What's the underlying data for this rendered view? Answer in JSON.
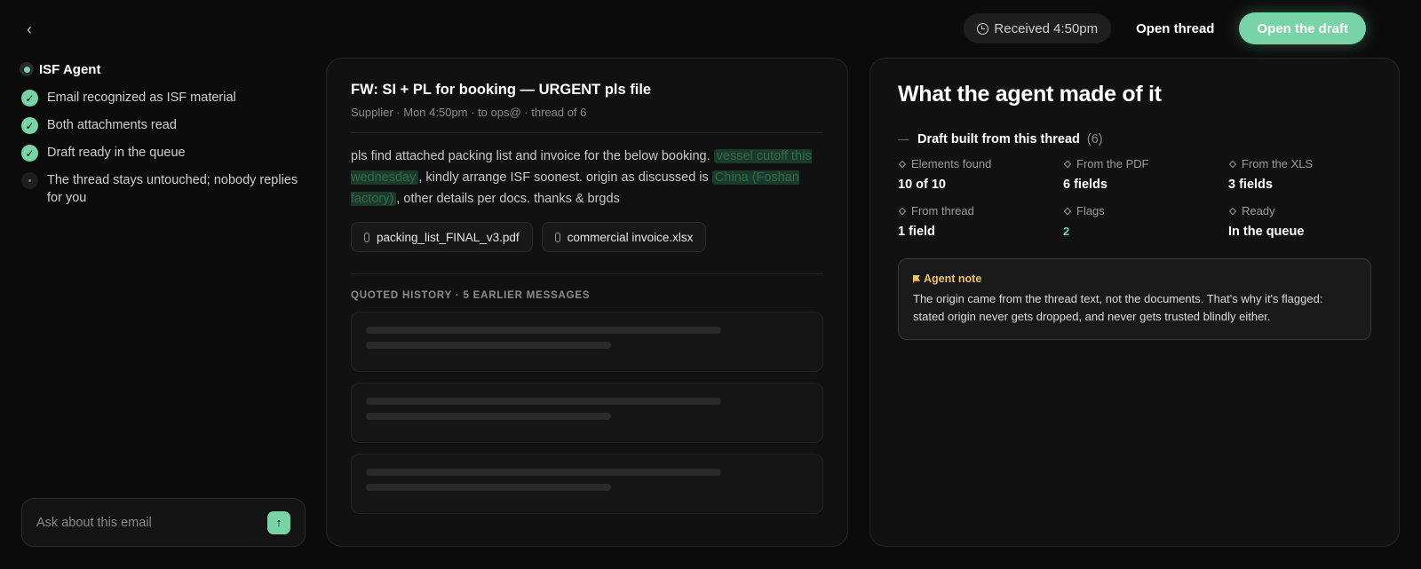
{
  "topbar": {
    "received_label": "Received 4:50pm",
    "open_thread_label": "Open thread",
    "open_draft_label": "Open the draft",
    "accent_color": "#78d3a6"
  },
  "sidebar": {
    "agent_name": "ISF Agent",
    "steps": [
      {
        "label": "Email recognized as ISF material",
        "status": "done"
      },
      {
        "label": "Both attachments read",
        "status": "done"
      },
      {
        "label": "Draft ready in the queue",
        "status": "done"
      },
      {
        "label": "The thread stays untouched; nobody replies for you",
        "status": "pending"
      }
    ],
    "ask_placeholder": "Ask about this email"
  },
  "email": {
    "subject": "FW: SI + PL for booking — URGENT pls file",
    "meta": "Supplier · Mon 4:50pm · to ops@ · thread of 6",
    "body": {
      "part1": "pls find attached packing list and invoice for the below booking. ",
      "highlight1": "vessel cutoff this wednesday",
      "part2": ", kindly arrange ISF soonest. origin as discussed is ",
      "highlight2": "China (Foshan factory)",
      "part3": ", other details per docs. thanks & brgds"
    },
    "attachments": [
      {
        "name": "packing_list_FINAL_v3.pdf"
      },
      {
        "name": "commercial invoice.xlsx"
      }
    ],
    "history_header": "QUOTED HISTORY · 5 EARLIER MESSAGES"
  },
  "result": {
    "title": "What the agent made of it",
    "draft_title": "Draft built from this thread",
    "draft_count": "(6)",
    "stats": [
      {
        "label": "Elements found",
        "value": "10 of 10"
      },
      {
        "label": "From the PDF",
        "value": "6 fields"
      },
      {
        "label": "From the XLS",
        "value": "3 fields"
      },
      {
        "label": "From thread",
        "value": "1 field"
      },
      {
        "label": "Flags",
        "value": "2"
      },
      {
        "label": "Ready",
        "value": "In the queue"
      }
    ],
    "note_label": "Agent note",
    "note_text": "The origin came from the thread text, not the documents. That's why it's flagged: stated origin never gets dropped, and never gets trusted blindly either."
  }
}
